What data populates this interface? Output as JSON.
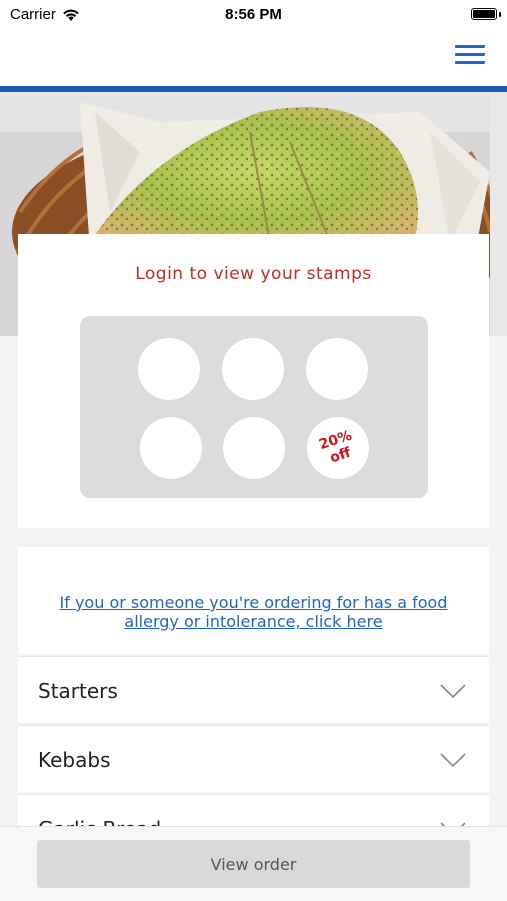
{
  "status_bar": {
    "carrier": "Carrier",
    "time": "8:56 PM"
  },
  "nav": {
    "menu_icon": "hamburger-menu-icon",
    "accent_color": "#1e66c8"
  },
  "hero": {
    "image": "garlic-naan-bread-in-basket"
  },
  "stamps": {
    "title": "Login to view your stamps",
    "total": 6,
    "reward_text": [
      "20%",
      "off"
    ],
    "reward_color": "#d4141c"
  },
  "allergy": {
    "link_line1": "If you or someone you're ordering for has a food",
    "link_line2": "allergy or intolerance, click here"
  },
  "menu": {
    "categories": [
      {
        "label": "Starters",
        "icon": "chevron-down-icon"
      },
      {
        "label": "Kebabs",
        "icon": "chevron-down-icon"
      },
      {
        "label": "Garlic Bread",
        "icon": "chevron-down-icon"
      }
    ]
  },
  "footer": {
    "view_order_label": "View order"
  }
}
